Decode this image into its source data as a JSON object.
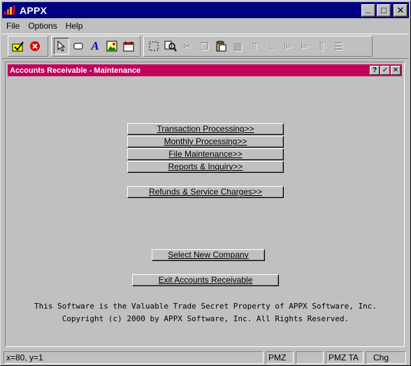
{
  "window": {
    "title": "APPX"
  },
  "window_controls": {
    "minimize": "_",
    "maximize": "□",
    "close": "✕"
  },
  "menu": [
    "File",
    "Options",
    "Help"
  ],
  "toolbar": {
    "group1": [
      {
        "name": "save-check-icon",
        "glyph": "✓"
      },
      {
        "name": "stop-icon",
        "glyph": "✕"
      }
    ],
    "group2": [
      {
        "name": "pointer-icon",
        "glyph": "↖"
      },
      {
        "name": "rectangle-icon",
        "glyph": "▭"
      },
      {
        "name": "text-tool-icon",
        "glyph": "A"
      },
      {
        "name": "image-tool-icon",
        "glyph": "▣"
      },
      {
        "name": "calendar-icon",
        "glyph": "▤"
      }
    ],
    "group3": [
      {
        "name": "marquee-icon",
        "glyph": "⬚"
      },
      {
        "name": "find-icon",
        "glyph": "⌕"
      },
      {
        "name": "cut-icon",
        "glyph": "✂"
      },
      {
        "name": "copy-icon",
        "glyph": "❐"
      },
      {
        "name": "paste-icon",
        "glyph": "▥"
      },
      {
        "name": "properties-icon",
        "glyph": "▦"
      },
      {
        "name": "align-top-icon",
        "glyph": "⫪"
      },
      {
        "name": "align-bottom-icon",
        "glyph": "⫫"
      },
      {
        "name": "align-left-icon",
        "glyph": "⊫"
      },
      {
        "name": "align-right-icon",
        "glyph": "⊨"
      },
      {
        "name": "same-width-icon",
        "glyph": "⫼"
      },
      {
        "name": "same-height-icon",
        "glyph": "☰"
      }
    ]
  },
  "child_window": {
    "title": "Accounts Receivable - Maintenance",
    "buttons": {
      "help": "?",
      "ok": "✓",
      "close": "✕"
    }
  },
  "menu_buttons": {
    "transaction": "Transaction Processing>>",
    "monthly": "Monthly Processing>>",
    "file_maint": "File Maintenance>>",
    "reports": "Reports & Inquiry>>",
    "refunds": "Refunds & Service Charges>>",
    "select_company": "Select New Company",
    "exit": "Exit Accounts Receivable"
  },
  "footer": {
    "line1": "This Software is the Valuable Trade Secret Property of APPX Software, Inc.",
    "line2": "Copyright (c) 2000 by APPX Software, Inc. All Rights Reserved."
  },
  "status": {
    "position": "x=80, y=1",
    "field2": "PMZ",
    "field3": "",
    "field4": "PMZ TA",
    "field5": "Chg"
  },
  "colors": {
    "titlebar": "#000080",
    "child_titlebar": "#c2005c",
    "face": "#c0c0c0"
  }
}
